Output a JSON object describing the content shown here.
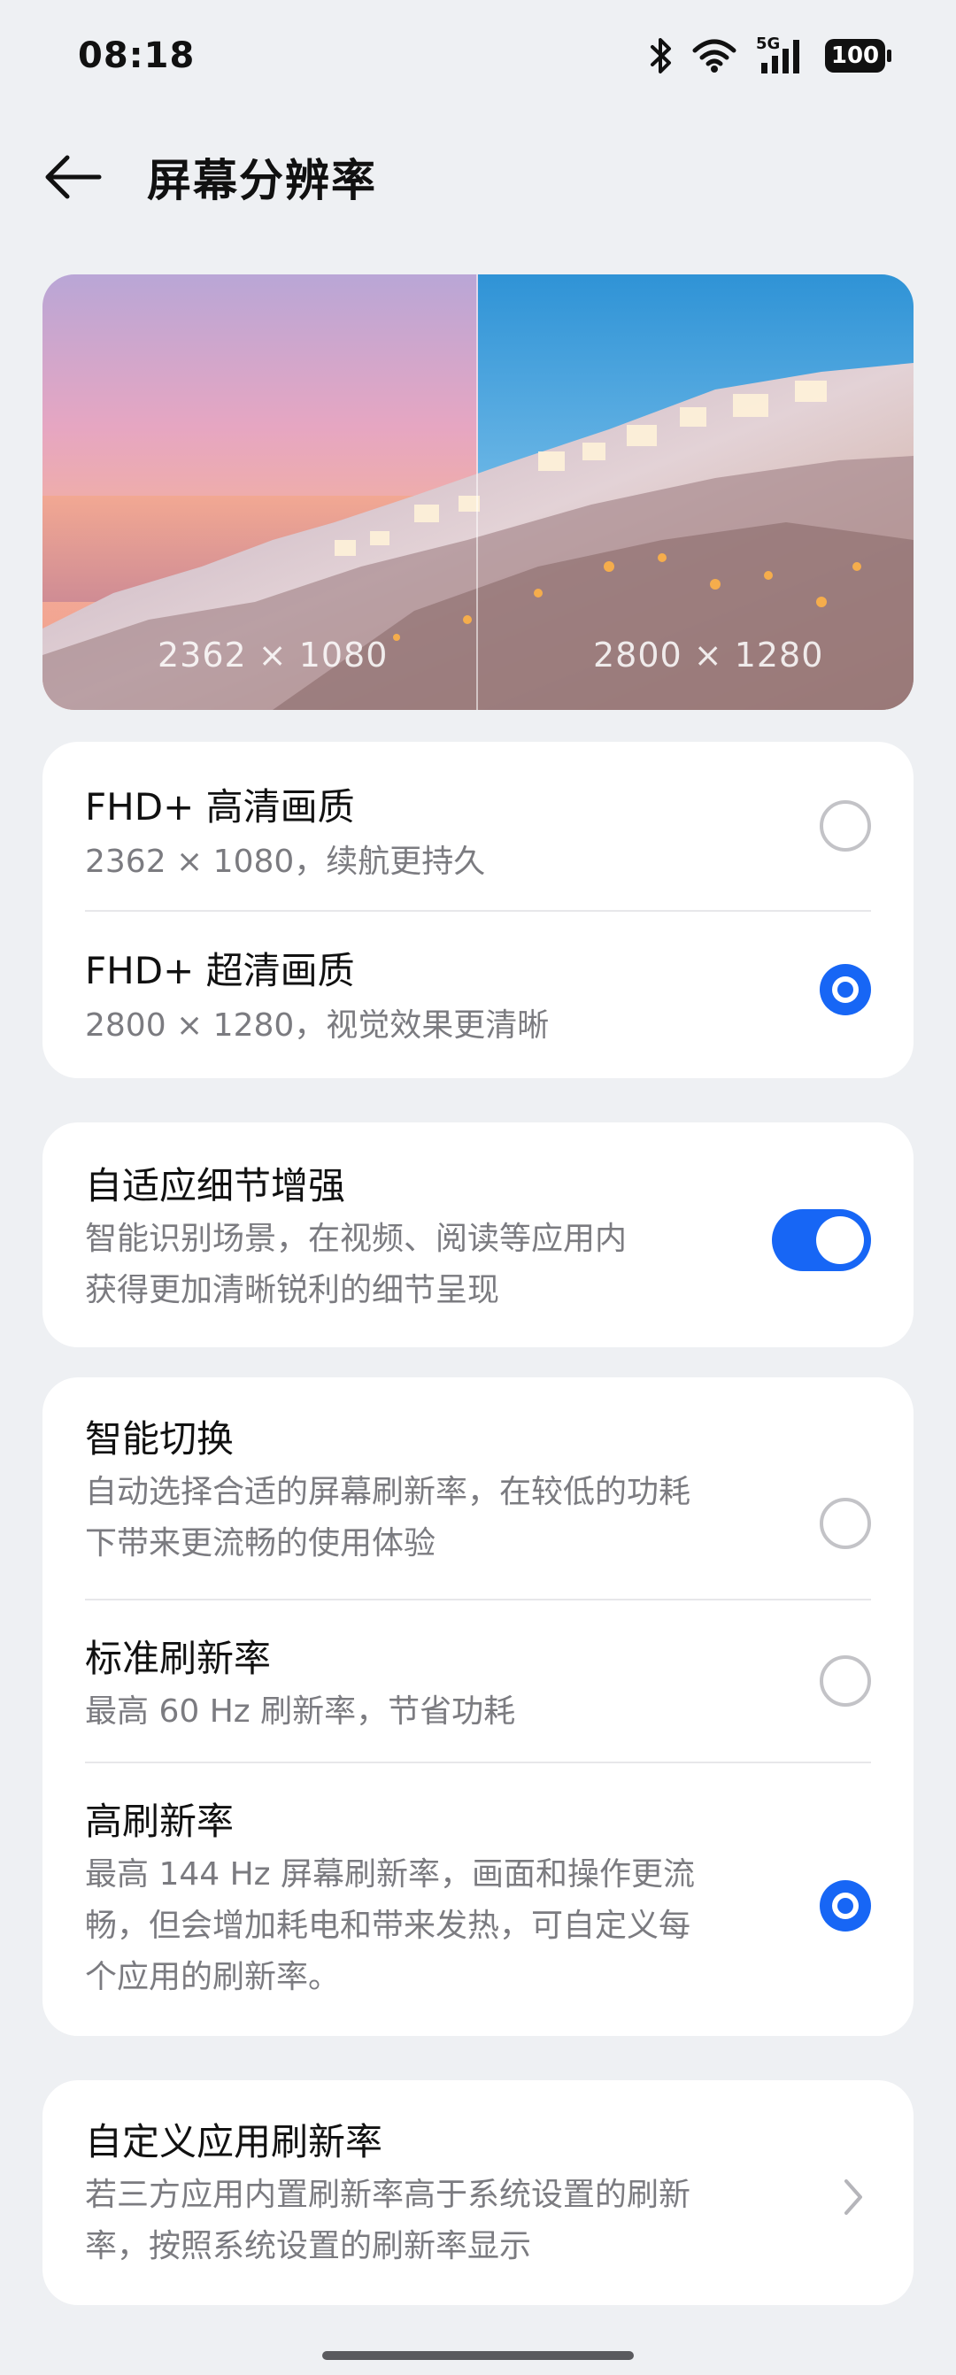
{
  "status_bar": {
    "time": "08:18",
    "signal_label": "5G",
    "battery": "100"
  },
  "header": {
    "title": "屏幕分辨率"
  },
  "preview": {
    "left_resolution": "2362 × 1080",
    "right_resolution": "2800 × 1280"
  },
  "resolution_options": [
    {
      "title": "FHD+ 高清画质",
      "subtitle": "2362 × 1080，续航更持久",
      "selected": false
    },
    {
      "title": "FHD+ 超清画质",
      "subtitle": "2800 × 1280，视觉效果更清晰",
      "selected": true
    }
  ],
  "detail_enhance": {
    "title": "自适应细节增强",
    "subtitle_line1": "智能识别场景，在视频、阅读等应用内",
    "subtitle_line2": "获得更加清晰锐利的细节呈现",
    "enabled": true
  },
  "refresh_options": [
    {
      "title": "智能切换",
      "subtitle_line1": "自动选择合适的屏幕刷新率，在较低的功耗",
      "subtitle_line2": "下带来更流畅的使用体验",
      "selected": false
    },
    {
      "title": "标准刷新率",
      "subtitle_line1": "最高 60 Hz 刷新率，节省功耗",
      "selected": false
    },
    {
      "title": "高刷新率",
      "subtitle_line1": "最高 144 Hz 屏幕刷新率，画面和操作更流",
      "subtitle_line2": "畅，但会增加耗电和带来发热，可自定义每",
      "subtitle_line3": "个应用的刷新率。",
      "selected": true
    }
  ],
  "custom_refresh": {
    "title": "自定义应用刷新率",
    "subtitle_line1": "若三方应用内置刷新率高于系统设置的刷新",
    "subtitle_line2": "率，按照系统设置的刷新率显示"
  },
  "colors": {
    "accent": "#1766f5",
    "background": "#eef0f3"
  }
}
